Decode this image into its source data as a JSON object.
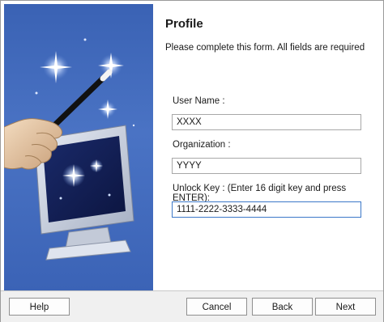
{
  "page": {
    "title": "Profile",
    "subtitle": "Please complete this form. All fields are required"
  },
  "form": {
    "username": {
      "label": "User Name :",
      "value": "XXXX"
    },
    "organization": {
      "label": "Organization :",
      "value": "YYYY"
    },
    "unlock_key": {
      "label": "Unlock Key : (Enter 16 digit key and press ENTER):",
      "value": "1111-2222-3333-4444"
    }
  },
  "footer": {
    "help_label": "Help",
    "cancel_label": "Cancel",
    "back_label": "Back",
    "next_label": "Next"
  },
  "colors": {
    "side_panel": "#3f68b9",
    "active_border": "#3c78c8"
  }
}
